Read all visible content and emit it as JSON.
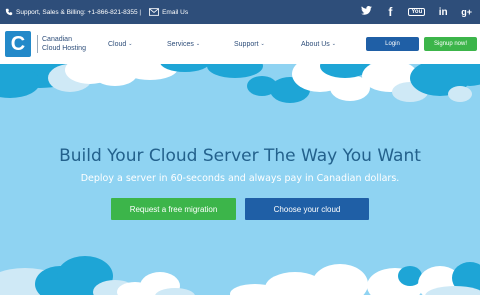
{
  "topbar": {
    "support_text": "Support, Sales & Billing: +1-866-821-8355 |",
    "email_text": "Email Us",
    "social": [
      {
        "name": "twitter-icon",
        "glyph": "𝕥"
      },
      {
        "name": "facebook-icon",
        "glyph": "f"
      },
      {
        "name": "youtube-icon",
        "glyph": "You"
      },
      {
        "name": "linkedin-icon",
        "glyph": "in"
      },
      {
        "name": "googleplus-icon",
        "glyph": "g+"
      }
    ]
  },
  "header": {
    "logo_letter": "C",
    "logo_line1": "Canadian",
    "logo_line2": "Cloud Hosting",
    "nav": [
      {
        "label": "Cloud"
      },
      {
        "label": "Services"
      },
      {
        "label": "Support"
      },
      {
        "label": "About Us"
      }
    ],
    "login_label": "Login",
    "signup_label": "Signup now!"
  },
  "hero": {
    "title": "Build Your Cloud Server The Way You Want",
    "subtitle": "Deploy a server in 60-seconds and always pay in Canadian dollars.",
    "migrate_label": "Request a free migration",
    "choose_label": "Choose your cloud"
  },
  "colors": {
    "topbar_bg": "#2e4e7a",
    "sky": "#8fd3f2",
    "cloud_dark": "#1ea5d6",
    "green": "#3cb54a",
    "blue": "#1f5fa6"
  }
}
